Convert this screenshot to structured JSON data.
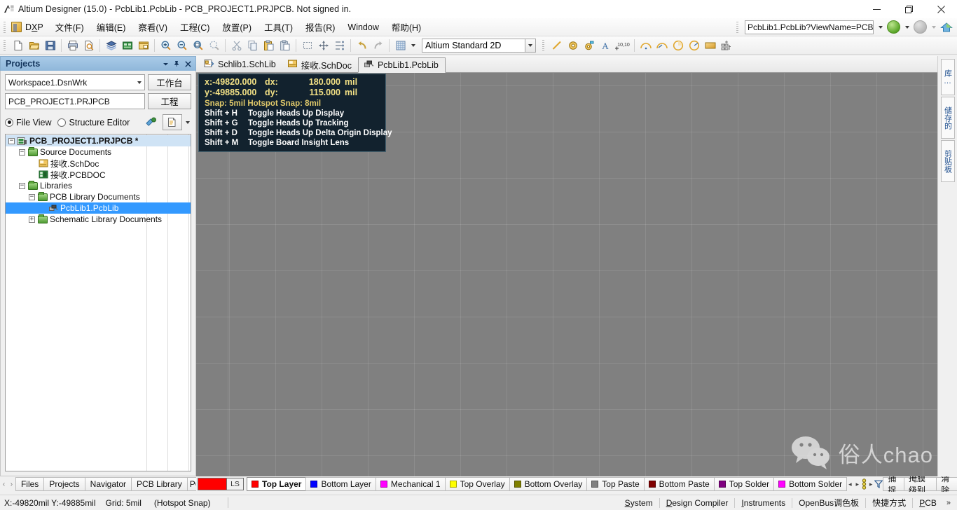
{
  "window": {
    "title": "Altium Designer (15.0) - PcbLib1.PcbLib - PCB_PROJECT1.PRJPCB. Not signed in.",
    "app_icon": "altium-logo-icon",
    "minimize_label": "—",
    "maximize_label": "❐",
    "close_label": "✕"
  },
  "menubar": {
    "items": [
      {
        "label": "DXP",
        "accel": "X"
      },
      {
        "label": "文件(F)"
      },
      {
        "label": "编辑(E)"
      },
      {
        "label": "察看(V)"
      },
      {
        "label": "工程(C)"
      },
      {
        "label": "放置(P)"
      },
      {
        "label": "工具(T)"
      },
      {
        "label": "报告(R)"
      },
      {
        "label": "Window"
      },
      {
        "label": "帮助(H)"
      }
    ],
    "address_value": "PcbLib1.PcbLib?ViewName=PCB",
    "nav_back": "navigate-back",
    "nav_forward": "navigate-forward",
    "home": "home-icon"
  },
  "toolbar": {
    "style_selector_value": "Altium Standard 2D",
    "buttons": [
      "new-document-icon",
      "open-document-icon",
      "save-icon",
      "print-icon",
      "print-preview-icon",
      "board-layers-icon",
      "pcb-board-icon",
      "open-window-icon",
      "zoom-in-icon",
      "zoom-out-icon",
      "zoom-document-icon",
      "zoom-area-icon",
      "cut-icon",
      "copy-icon",
      "paste-icon",
      "paste-special-icon",
      "select-area-icon",
      "move-icon",
      "align-icon",
      "undo-icon",
      "redo-icon",
      "grid-icon",
      "place-line-icon",
      "place-pad-icon",
      "place-via-icon",
      "place-string-icon",
      "place-coordinate-icon",
      "place-arc-center-icon",
      "place-arc-edge-icon",
      "place-arc-any-icon",
      "place-full-circle-icon",
      "place-fill-icon",
      "component-wizard-icon"
    ]
  },
  "projects_panel": {
    "title": "Projects",
    "header_buttons": [
      "panel-menu-icon",
      "pin-icon",
      "close-icon"
    ],
    "workspace_value": "Workspace1.DsnWrk",
    "workspace_button": "工作台",
    "project_value": "PCB_PROJECT1.PRJPCB",
    "project_button": "工程",
    "view_modes": [
      {
        "label": "File View",
        "selected": true
      },
      {
        "label": "Structure Editor",
        "selected": false
      }
    ],
    "action_icons": [
      "compile-icon",
      "document-options-icon",
      "dropdown-arrow-icon"
    ],
    "tree": [
      {
        "indent": 0,
        "expander": "-",
        "icon": "project-icon",
        "label": "PCB_PROJECT1.PRJPCB *",
        "bold": true,
        "state": "soft"
      },
      {
        "indent": 1,
        "expander": "-",
        "icon": "folder-icon",
        "label": "Source Documents",
        "bold": false,
        "state": "none"
      },
      {
        "indent": 2,
        "expander": "",
        "icon": "schdoc-icon",
        "label": "接收.SchDoc",
        "bold": false,
        "state": "none"
      },
      {
        "indent": 2,
        "expander": "",
        "icon": "pcbdoc-icon",
        "label": "接收.PCBDOC",
        "bold": false,
        "state": "none"
      },
      {
        "indent": 1,
        "expander": "-",
        "icon": "folder-icon",
        "label": "Libraries",
        "bold": false,
        "state": "none"
      },
      {
        "indent": 2,
        "expander": "-",
        "icon": "folder-icon",
        "label": "PCB Library Documents",
        "bold": false,
        "state": "none"
      },
      {
        "indent": 3,
        "expander": "",
        "icon": "pcblib-icon",
        "label": "PcbLib1.PcbLib",
        "bold": false,
        "state": "selected"
      },
      {
        "indent": 2,
        "expander": "+",
        "icon": "folder-icon",
        "label": "Schematic Library Documents",
        "bold": false,
        "state": "none"
      }
    ]
  },
  "document_tabs": [
    {
      "label": "Schlib1.SchLib",
      "icon": "schlib-icon",
      "active": false
    },
    {
      "label": "接收.SchDoc",
      "icon": "schdoc-icon",
      "active": false
    },
    {
      "label": "PcbLib1.PcbLib",
      "icon": "pcblib-icon",
      "active": true
    }
  ],
  "heads_up_display": {
    "x_label": "x:-49820.000",
    "dx_label": "dx:",
    "dx_value": "180.000",
    "dx_unit": "mil",
    "y_label": "y:-49885.000",
    "dy_label": "dy:",
    "dy_value": "115.000",
    "dy_unit": "mil",
    "snap_line": "Snap: 5mil Hotspot Snap: 8mil",
    "shortcuts": [
      {
        "key": "Shift + H",
        "action": "Toggle Heads Up Display"
      },
      {
        "key": "Shift + G",
        "action": "Toggle Heads Up Tracking"
      },
      {
        "key": "Shift + D",
        "action": "Toggle Heads Up Delta Origin Display"
      },
      {
        "key": "Shift + M",
        "action": "Toggle Board Insight Lens"
      }
    ]
  },
  "watermark": {
    "icon": "wechat-icon",
    "text": "俗人chao"
  },
  "right_tabs": [
    {
      "label": "库…"
    },
    {
      "label": "储存的"
    },
    {
      "label": "剪贴板"
    }
  ],
  "panel_tabs": {
    "prev": "‹",
    "next": "›",
    "items": [
      "Files",
      "Projects",
      "Navigator",
      "PCB Library",
      "PC"
    ]
  },
  "layer_tabs": {
    "ls_label": "LS",
    "ls_color": "#ff0000",
    "items": [
      {
        "label": "Top Layer",
        "color": "#ff0000",
        "active": true
      },
      {
        "label": "Bottom Layer",
        "color": "#0000ff",
        "active": false
      },
      {
        "label": "Mechanical 1",
        "color": "#ff00ff",
        "active": false
      },
      {
        "label": "Top Overlay",
        "color": "#ffff00",
        "active": false
      },
      {
        "label": "Bottom Overlay",
        "color": "#808000",
        "active": false
      },
      {
        "label": "Top Paste",
        "color": "#808080",
        "active": false
      },
      {
        "label": "Bottom Paste",
        "color": "#800000",
        "active": false
      },
      {
        "label": "Top Solder",
        "color": "#800080",
        "active": false
      },
      {
        "label": "Bottom Solder",
        "color": "#ff00ff",
        "active": false
      }
    ],
    "buttons": [
      "捕捉",
      "掩膜级别",
      "清除"
    ],
    "nav_prev": "◂",
    "nav_next": "▸",
    "filter_icon": "filter-icon"
  },
  "statusbar": {
    "coords": "X:-49820mil Y:-49885mil",
    "grid": "Grid: 5mil",
    "snap_mode": "(Hotspot Snap)",
    "right_buttons": [
      "System",
      "Design Compiler",
      "Instruments",
      "OpenBus调色板",
      "快捷方式",
      "PCB"
    ],
    "more": "»"
  },
  "colors": {
    "canvas_bg": "#808080",
    "panel_header": "#8fb7da",
    "tree_selection": "#3399ff",
    "hud_bg": "#12222e",
    "hud_yellow": "#f2e085"
  }
}
